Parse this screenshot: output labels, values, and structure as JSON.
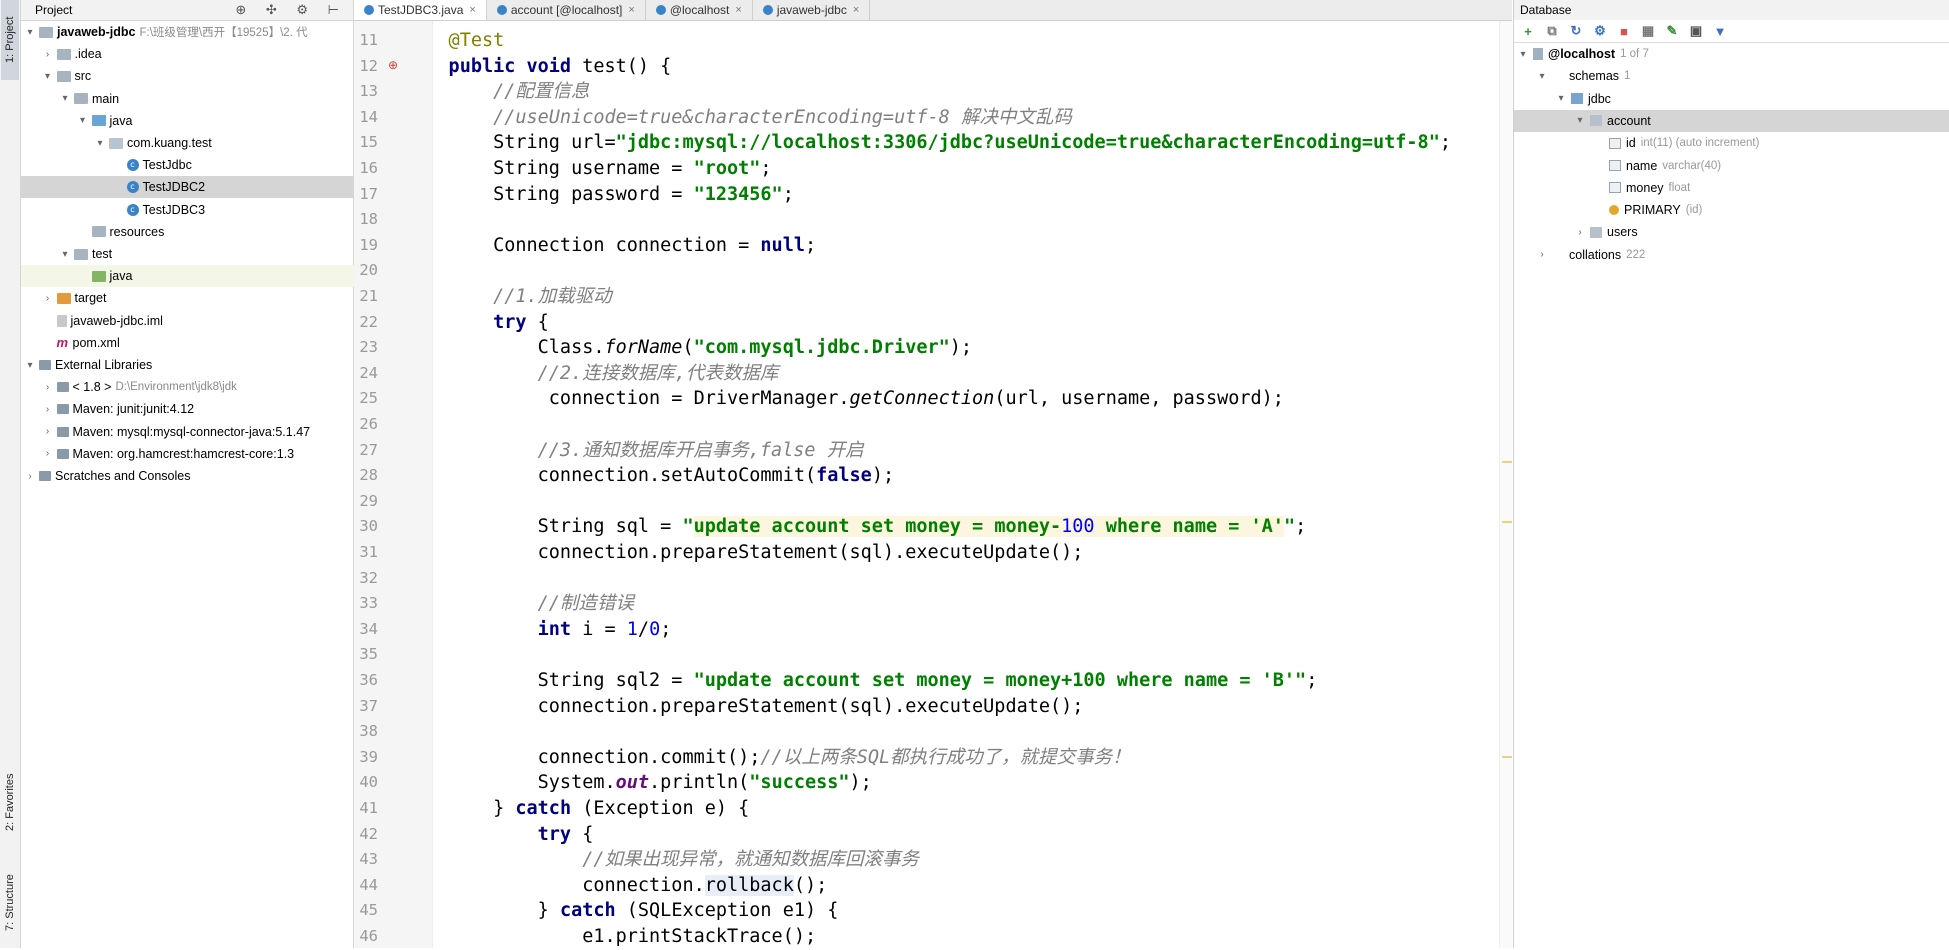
{
  "left_strip": {
    "project": "1: Project",
    "favorites": "2: Favorites",
    "structure": "7: Structure"
  },
  "project_panel": {
    "title": "Project",
    "header_icons": "⊕ ✣ ⚙ ⊢",
    "tree": [
      {
        "label": "javaweb-jdbc",
        "extra": "F:\\班级管理\\西开【19525】\\2. 代",
        "arrow": "▾",
        "icon": "folder",
        "indent": 0
      },
      {
        "label": ".idea",
        "extra": "",
        "arrow": "›",
        "icon": "folder",
        "indent": 1
      },
      {
        "label": "src",
        "extra": "",
        "arrow": "▾",
        "icon": "folder",
        "indent": 1
      },
      {
        "label": "main",
        "extra": "",
        "arrow": "▾",
        "icon": "folder",
        "indent": 2
      },
      {
        "label": "java",
        "extra": "",
        "arrow": "▾",
        "icon": "folder-blue",
        "indent": 3
      },
      {
        "label": "com.kuang.test",
        "extra": "",
        "arrow": "▾",
        "icon": "package",
        "indent": 4
      },
      {
        "label": "TestJdbc",
        "extra": "",
        "arrow": "",
        "icon": "class",
        "indent": 5
      },
      {
        "label": "TestJDBC2",
        "extra": "",
        "arrow": "",
        "icon": "class",
        "indent": 5,
        "selected": true
      },
      {
        "label": "TestJDBC3",
        "extra": "",
        "arrow": "",
        "icon": "class",
        "indent": 5
      },
      {
        "label": "resources",
        "extra": "",
        "arrow": "",
        "icon": "folder",
        "indent": 3
      },
      {
        "label": "test",
        "extra": "",
        "arrow": "▾",
        "icon": "folder",
        "indent": 2
      },
      {
        "label": "java",
        "extra": "",
        "arrow": "",
        "icon": "folder-green",
        "indent": 3,
        "highlight": true
      },
      {
        "label": "target",
        "extra": "",
        "arrow": "›",
        "icon": "folder-orange",
        "indent": 1
      },
      {
        "label": "javaweb-jdbc.iml",
        "extra": "",
        "arrow": "",
        "icon": "file",
        "indent": 1
      },
      {
        "label": "pom.xml",
        "extra": "",
        "arrow": "",
        "icon": "maven",
        "indent": 1
      },
      {
        "label": "External Libraries",
        "extra": "",
        "arrow": "▾",
        "icon": "library",
        "indent": 0
      },
      {
        "label": "< 1.8 >",
        "extra": "D:\\Environment\\jdk8\\jdk",
        "arrow": "›",
        "icon": "library",
        "indent": 1
      },
      {
        "label": "Maven: junit:junit:4.12",
        "extra": "",
        "arrow": "›",
        "icon": "library",
        "indent": 1
      },
      {
        "label": "Maven: mysql:mysql-connector-java:5.1.47",
        "extra": "",
        "arrow": "›",
        "icon": "library",
        "indent": 1
      },
      {
        "label": "Maven: org.hamcrest:hamcrest-core:1.3",
        "extra": "",
        "arrow": "›",
        "icon": "library",
        "indent": 1
      },
      {
        "label": "Scratches and Consoles",
        "extra": "",
        "arrow": "›",
        "icon": "library",
        "indent": 0
      }
    ]
  },
  "editor": {
    "tabs": [
      {
        "label": "TestJDBC3.java",
        "active": true
      },
      {
        "label": "account [@localhost]",
        "active": false
      },
      {
        "label": "@localhost",
        "active": false
      },
      {
        "label": "javaweb-jdbc",
        "active": false
      }
    ],
    "tab_close": "×",
    "line_numbers": [
      "11",
      "12",
      "13",
      "14",
      "15",
      "16",
      "17",
      "18",
      "19",
      "20",
      "21",
      "22",
      "23",
      "24",
      "25",
      "26",
      "27",
      "28",
      "29",
      "30",
      "31",
      "32",
      "33",
      "34",
      "35",
      "36",
      "37",
      "38",
      "39",
      "40",
      "41",
      "42",
      "43",
      "44",
      "45",
      "46"
    ],
    "gutter_icons": [
      {
        "line_index": 1,
        "name": "test-run-icon",
        "glyph": "⊕"
      }
    ],
    "code_lines": [
      [
        [
          "ann",
          "    @Test"
        ]
      ],
      [
        [
          "kw",
          "    public void "
        ],
        [
          "",
          "test() {"
        ]
      ],
      [
        [
          "cm",
          "        //配置信息"
        ]
      ],
      [
        [
          "cm",
          "        //useUnicode=true&characterEncoding=utf-8 解决中文乱码"
        ]
      ],
      [
        [
          "",
          "        String url="
        ],
        [
          "str",
          "\"jdbc:mysql://localhost:3306/jdbc?useUnicode=true&characterEncoding=utf-8\""
        ],
        [
          "",
          ";"
        ]
      ],
      [
        [
          "",
          "        String username = "
        ],
        [
          "str",
          "\"root\""
        ],
        [
          "",
          ";"
        ]
      ],
      [
        [
          "",
          "        String password = "
        ],
        [
          "str",
          "\"123456\""
        ],
        [
          "",
          ";"
        ]
      ],
      [],
      [
        [
          "",
          "        Connection connection = "
        ],
        [
          "kw",
          "null"
        ],
        [
          "",
          ";"
        ]
      ],
      [],
      [
        [
          "cm",
          "        //1.加载驱动"
        ]
      ],
      [
        [
          "kw",
          "        try "
        ],
        [
          "",
          "{"
        ]
      ],
      [
        [
          "",
          "            Class."
        ],
        [
          "it",
          "forName"
        ],
        [
          "",
          "("
        ],
        [
          "str",
          "\"com.mysql.jdbc.Driver\""
        ],
        [
          "",
          ");"
        ]
      ],
      [
        [
          "cm",
          "            //2.连接数据库,代表数据库"
        ]
      ],
      [
        [
          "",
          "             connection = DriverManager."
        ],
        [
          "it",
          "getConnection"
        ],
        [
          "",
          "(url, username, password);"
        ]
      ],
      [],
      [
        [
          "cm",
          "            //3.通知数据库开启事务,false 开启"
        ]
      ],
      [
        [
          "",
          "            connection.setAutoCommit("
        ],
        [
          "kw",
          "false"
        ],
        [
          "",
          ");"
        ]
      ],
      [],
      [
        [
          "",
          "            String sql = "
        ],
        [
          "str",
          "\""
        ],
        [
          "sqlkw",
          "update account set "
        ],
        [
          "sql",
          "money = money-"
        ],
        [
          "sqlnum",
          "100"
        ],
        [
          "sqlkw",
          " where "
        ],
        [
          "sql",
          "name = "
        ],
        [
          "sqlstr",
          "'A'"
        ],
        [
          "str",
          "\""
        ],
        [
          "",
          ";"
        ]
      ],
      [
        [
          "",
          "            connection.prepareStatement(sql).executeUpdate();"
        ]
      ],
      [],
      [
        [
          "cm",
          "            //制造错误"
        ]
      ],
      [
        [
          "kw",
          "            int "
        ],
        [
          "",
          "i = "
        ],
        [
          "num",
          "1"
        ],
        [
          "",
          "/"
        ],
        [
          "num",
          "0"
        ],
        [
          "",
          ";"
        ]
      ],
      [],
      [
        [
          "",
          "            String sql2 = "
        ],
        [
          "str",
          "\"update account set money = money+100 where name = 'B'\""
        ],
        [
          "",
          ";"
        ]
      ],
      [
        [
          "",
          "            connection.prepareStatement(sql).executeUpdate();"
        ]
      ],
      [],
      [
        [
          "",
          "            connection.commit();"
        ],
        [
          "cm",
          "//以上两条SQL都执行成功了，就提交事务！"
        ]
      ],
      [
        [
          "",
          "            System."
        ],
        [
          "st",
          "out"
        ],
        [
          "",
          ".println("
        ],
        [
          "str",
          "\"success\""
        ],
        [
          "",
          ");"
        ]
      ],
      [
        [
          "",
          "        } "
        ],
        [
          "kw",
          "catch "
        ],
        [
          "",
          "(Exception e) {"
        ]
      ],
      [
        [
          "kw",
          "            try "
        ],
        [
          "",
          "{"
        ]
      ],
      [
        [
          "cm",
          "                //如果出现异常，就通知数据库回滚事务"
        ]
      ],
      [
        [
          "",
          "                connection."
        ],
        [
          "rb",
          "rollback"
        ],
        [
          "",
          "();"
        ]
      ],
      [
        [
          "",
          "            } "
        ],
        [
          "kw",
          "catch "
        ],
        [
          "",
          "(SQLException e1) {"
        ]
      ],
      [
        [
          "",
          "                e1.printStackTrace();"
        ]
      ]
    ]
  },
  "database": {
    "title": "Database",
    "toolbar": [
      {
        "name": "add-icon",
        "glyph": "+",
        "color": "#3a8f3a"
      },
      {
        "name": "copy-icon",
        "glyph": "⧉",
        "color": "#777777"
      },
      {
        "name": "refresh-icon",
        "glyph": "↻",
        "color": "#3a6fc4"
      },
      {
        "name": "schema-icon",
        "glyph": "⚙",
        "color": "#3a6fc4"
      },
      {
        "name": "stop-icon",
        "glyph": "■",
        "color": "#d9534f"
      },
      {
        "name": "table-icon",
        "glyph": "▦",
        "color": "#777777"
      },
      {
        "name": "edit-icon",
        "glyph": "✎",
        "color": "#3a8f3a"
      },
      {
        "name": "console-icon",
        "glyph": "▣",
        "color": "#555555"
      },
      {
        "name": "filter-icon",
        "glyph": "▼",
        "color": "#3a6fc4"
      }
    ],
    "tree": [
      {
        "label": "@localhost",
        "dim": "1 of 7",
        "arrow": "▾",
        "icon": "host",
        "indent": 0,
        "bold": true
      },
      {
        "label": "schemas",
        "dim": "1",
        "arrow": "▾",
        "icon": "none",
        "indent": 1
      },
      {
        "label": "jdbc",
        "dim": "",
        "arrow": "▾",
        "icon": "schema",
        "indent": 2
      },
      {
        "label": "account",
        "dim": "",
        "arrow": "▾",
        "icon": "table",
        "indent": 3,
        "selected": true
      },
      {
        "label": "id",
        "dim": "int(11) (auto increment)",
        "arrow": "",
        "icon": "column",
        "indent": 4
      },
      {
        "label": "name",
        "dim": "varchar(40)",
        "arrow": "",
        "icon": "column",
        "indent": 4
      },
      {
        "label": "money",
        "dim": "float",
        "arrow": "",
        "icon": "column",
        "indent": 4
      },
      {
        "label": "PRIMARY",
        "dim": "(id)",
        "arrow": "",
        "icon": "key",
        "indent": 4
      },
      {
        "label": "users",
        "dim": "",
        "arrow": "›",
        "icon": "table",
        "indent": 3
      },
      {
        "label": "collations",
        "dim": "222",
        "arrow": "›",
        "icon": "none",
        "indent": 1
      }
    ]
  }
}
